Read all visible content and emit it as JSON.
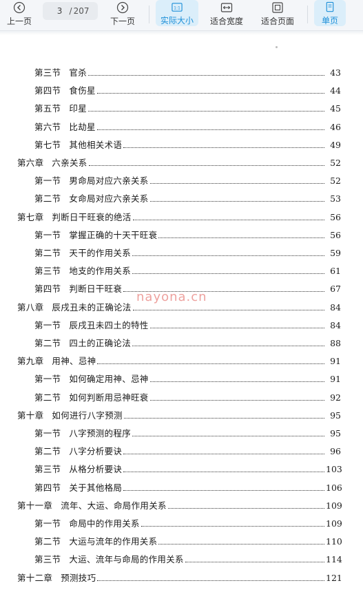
{
  "toolbar": {
    "prev_label": "上一页",
    "next_label": "下一页",
    "current_page": "3",
    "page_sep": "/",
    "total_pages": "207",
    "actual_size_label": "实际大小",
    "fit_width_label": "适合宽度",
    "fit_page_label": "适合页面",
    "single_page_label": "单页",
    "active_color": "#1d8fd8",
    "icons": [
      "chevron-left-icon",
      "chevron-right-icon",
      "actual-size-icon",
      "fit-width-icon",
      "fit-page-icon",
      "single-page-icon"
    ]
  },
  "watermark": "nayona.cn",
  "toc": [
    {
      "level": "section",
      "num": "第三节",
      "title": "官杀",
      "page": "43"
    },
    {
      "level": "section",
      "num": "第四节",
      "title": "食伤星",
      "page": "44"
    },
    {
      "level": "section",
      "num": "第五节",
      "title": "印星",
      "page": "45"
    },
    {
      "level": "section",
      "num": "第六节",
      "title": "比劫星",
      "page": "46"
    },
    {
      "level": "section",
      "num": "第七节",
      "title": "其他相关术语",
      "page": "49"
    },
    {
      "level": "chapter",
      "num": "第六章",
      "title": "六亲关系",
      "page": "52"
    },
    {
      "level": "section",
      "num": "第一节",
      "title": "男命局对应六亲关系",
      "page": "52"
    },
    {
      "level": "section",
      "num": "第二节",
      "title": "女命局对应六亲关系",
      "page": "53"
    },
    {
      "level": "chapter",
      "num": "第七章",
      "title": "判断日干旺衰的绝活",
      "page": "56"
    },
    {
      "level": "section",
      "num": "第一节",
      "title": "掌握正确的十天干旺衰",
      "page": "56"
    },
    {
      "level": "section",
      "num": "第二节",
      "title": "天干的作用关系",
      "page": "59"
    },
    {
      "level": "section",
      "num": "第三节",
      "title": "地支的作用关系",
      "page": "61"
    },
    {
      "level": "section",
      "num": "第四节",
      "title": "判断日干旺衰",
      "page": "67"
    },
    {
      "level": "chapter",
      "num": "第八章",
      "title": "辰戌丑未的正确论法",
      "page": "84"
    },
    {
      "level": "section",
      "num": "第一节",
      "title": "辰戌丑未四土的特性",
      "page": "84"
    },
    {
      "level": "section",
      "num": "第二节",
      "title": "四土的正确论法",
      "page": "88"
    },
    {
      "level": "chapter",
      "num": "第九章",
      "title": "用神、忌神",
      "page": "91"
    },
    {
      "level": "section",
      "num": "第一节",
      "title": "如何确定用神、忌神",
      "page": "91"
    },
    {
      "level": "section",
      "num": "第二节",
      "title": "如何判断用忌神旺衰",
      "page": "92"
    },
    {
      "level": "chapter",
      "num": "第十章",
      "title": "如何进行八字预测",
      "page": "95"
    },
    {
      "level": "section",
      "num": "第一节",
      "title": "八字预测的程序",
      "page": "95"
    },
    {
      "level": "section",
      "num": "第二节",
      "title": "八字分析要诀",
      "page": "96"
    },
    {
      "level": "section",
      "num": "第三节",
      "title": "从格分析要诀",
      "page": "103"
    },
    {
      "level": "section",
      "num": "第四节",
      "title": "关于其他格局",
      "page": "106"
    },
    {
      "level": "chapter",
      "num": "第十一章",
      "title": "流年、大运、命局作用关系",
      "page": "109"
    },
    {
      "level": "section",
      "num": "第一节",
      "title": "命局中的作用关系",
      "page": "109"
    },
    {
      "level": "section",
      "num": "第二节",
      "title": "大运与流年的作用关系",
      "page": "110"
    },
    {
      "level": "section",
      "num": "第三节",
      "title": "大运、流年与命局的作用关系",
      "page": "114"
    },
    {
      "level": "chapter",
      "num": "第十二章",
      "title": "预测技巧",
      "page": "121"
    }
  ]
}
